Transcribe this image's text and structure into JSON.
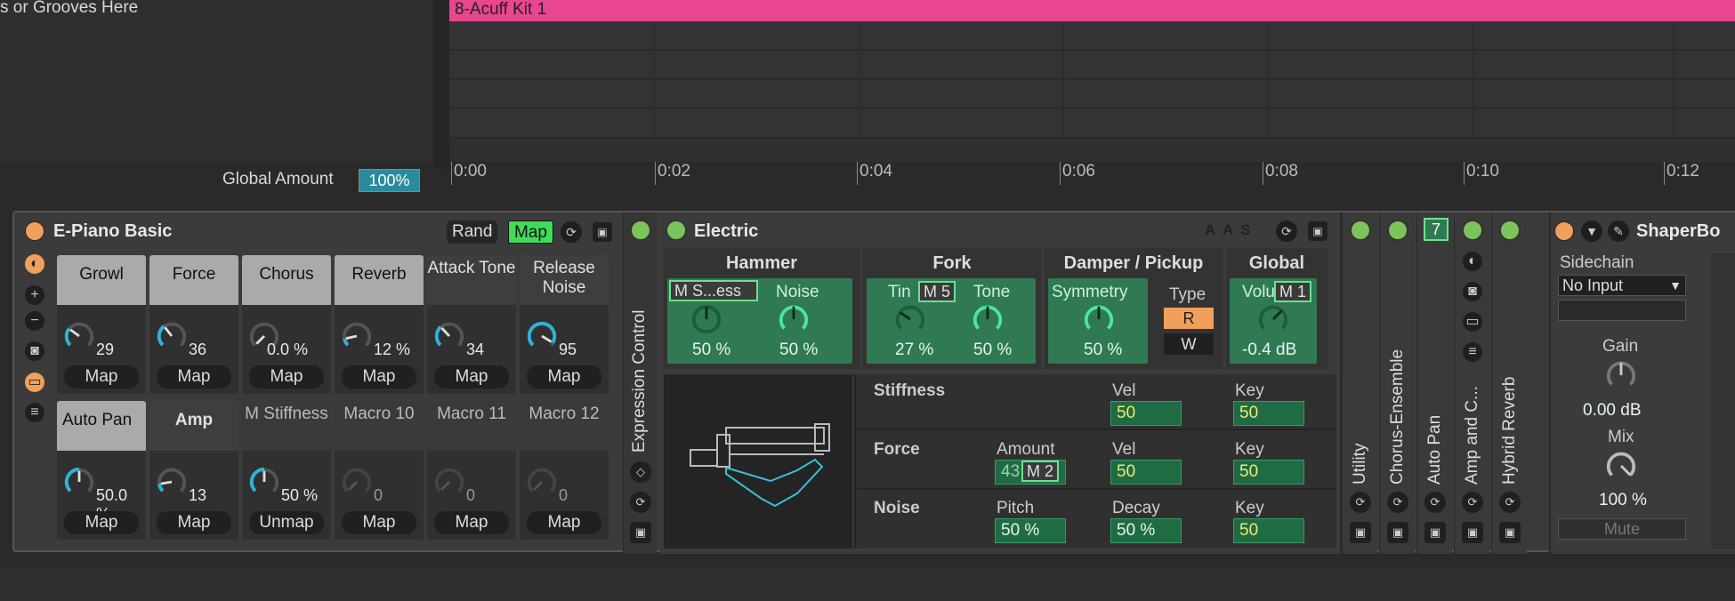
{
  "groove_hint": "s or Grooves Here",
  "clip_name": "8-Acuff Kit 1",
  "global_amount": {
    "label": "Global Amount",
    "value": "100%"
  },
  "ruler": [
    "0:00",
    "0:02",
    "0:04",
    "0:06",
    "0:08",
    "0:10",
    "0:12"
  ],
  "epiano": {
    "title": "E-Piano Basic",
    "rand_label": "Rand",
    "map_label": "Map",
    "macros": [
      {
        "name": "Growl",
        "value": "29",
        "btn": "Map"
      },
      {
        "name": "Force",
        "value": "36",
        "btn": "Map"
      },
      {
        "name": "Chorus",
        "value": "0.0 %",
        "btn": "Map"
      },
      {
        "name": "Reverb",
        "value": "12 %",
        "btn": "Map"
      },
      {
        "name": "Attack Tone",
        "value": "34",
        "btn": "Map"
      },
      {
        "name": "Release Noise",
        "value": "95",
        "btn": "Map"
      },
      {
        "name": "Auto Pan",
        "value": "50.0 %",
        "btn": "Map"
      },
      {
        "name": "Amp",
        "value": "13",
        "btn": "Map"
      },
      {
        "name": "M Stiffness",
        "value": "50 %",
        "btn": "Unmap"
      },
      {
        "name": "Macro 10",
        "value": "0",
        "btn": "Map"
      },
      {
        "name": "Macro 11",
        "value": "0",
        "btn": "Map"
      },
      {
        "name": "Macro 12",
        "value": "0",
        "btn": "Map"
      }
    ]
  },
  "expression_control": "Expression Control",
  "electric": {
    "title": "Electric",
    "flags": [
      "A",
      "A",
      "S"
    ],
    "hammer": {
      "title": "Hammer",
      "p1_label": "M S...ess",
      "p1_value": "50 %",
      "p2_label": "Noise",
      "p2_value": "50 %"
    },
    "fork": {
      "title": "Fork",
      "p1_label": "Tin",
      "p1_tag": "M 5",
      "p1_value": "27 %",
      "p2_label": "Tone",
      "p2_value": "50 %"
    },
    "damper": {
      "title": "Damper / Pickup",
      "p1_label": "Symmetry",
      "p1_value": "50 %",
      "type_label": "Type",
      "type_r": "R",
      "type_w": "W"
    },
    "global": {
      "title": "Global",
      "p1_label": "Volu",
      "p1_tag": "M 1",
      "p1_value": "-0.4 dB"
    },
    "rows": {
      "stiffness": {
        "label": "Stiffness",
        "vel_label": "Vel",
        "vel": "50",
        "key_label": "Key",
        "key": "50"
      },
      "force": {
        "label": "Force",
        "amount_label": "Amount",
        "amount": "43",
        "amount_tag": "M 2",
        "vel_label": "Vel",
        "vel": "50",
        "key_label": "Key",
        "key": "50"
      },
      "noise": {
        "label": "Noise",
        "pitch_label": "Pitch",
        "pitch": "50 %",
        "decay_label": "Decay",
        "decay": "50 %",
        "key_label": "Key",
        "key": "50"
      }
    }
  },
  "fx_strips": [
    "Utility",
    "Chorus-Ensemble",
    "Auto Pan",
    "Amp and C...",
    "Hybrid Reverb"
  ],
  "auto_pan_badge": "7",
  "shaper": {
    "title": "ShaperBo",
    "sidechain_label": "Sidechain",
    "sidechain_value": "No Input",
    "gain_label": "Gain",
    "gain_value": "0.00 dB",
    "mix_label": "Mix",
    "mix_value": "100 %",
    "mute_label": "Mute"
  },
  "colors": {
    "accent_green": "#3fdc5a",
    "clip_pink": "#e8468f",
    "panel_green": "#2f7a52",
    "knob_cyan": "#2bb5d8"
  }
}
